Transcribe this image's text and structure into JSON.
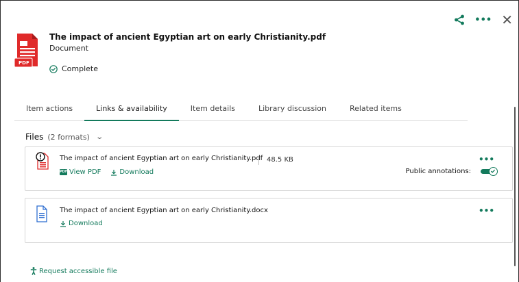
{
  "top_actions": {
    "share_icon": "share-icon",
    "more_icon": "more-dots-icon",
    "more_label": "•••",
    "close_icon": "close-icon",
    "close_label": "✕"
  },
  "document": {
    "title": "The impact of ancient Egyptian art on early Christianity.pdf",
    "type": "Document",
    "status": "Complete",
    "badge": "PDF"
  },
  "tabs": [
    {
      "label": "Item actions",
      "active": false
    },
    {
      "label": "Links & availability",
      "active": true
    },
    {
      "label": "Item details",
      "active": false
    },
    {
      "label": "Library discussion",
      "active": false
    },
    {
      "label": "Related items",
      "active": false
    }
  ],
  "files": {
    "heading": "Files",
    "count": "(2 formats)",
    "items": [
      {
        "name": "The impact of ancient Egyptian art on early Christianity.pdf",
        "size": "48.5 KB",
        "pdf_badge": "PDF",
        "view_label": "View PDF",
        "download_label": "Download",
        "more_label": "•••",
        "public_annotations_label": "Public annotations:",
        "public_annotations_on": true
      },
      {
        "name": "The impact of ancient Egyptian art on early Christianity.docx",
        "download_label": "Download",
        "more_label": "•••"
      }
    ]
  },
  "request_accessible": "Request accessible file",
  "colors": {
    "accent": "#137a5c",
    "pdf_red": "#e02a2a",
    "docx_blue": "#2f6fd1"
  }
}
